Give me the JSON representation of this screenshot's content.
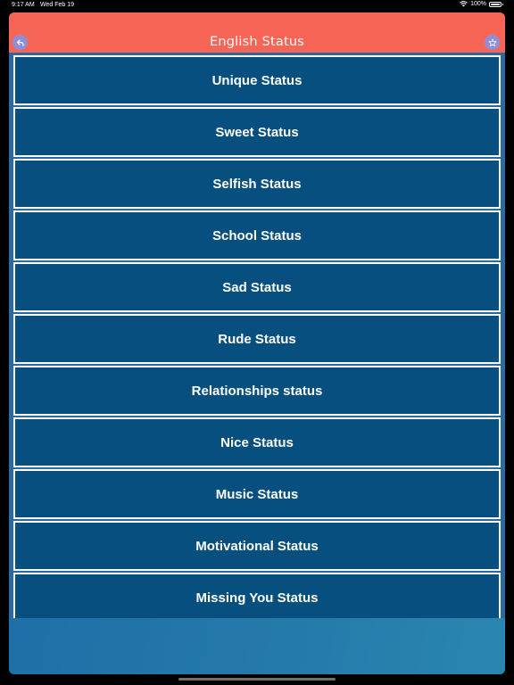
{
  "status_bar": {
    "time": "9:17 AM",
    "date": "Wed Feb 19",
    "battery": "100%"
  },
  "header": {
    "title": "English Status",
    "back_icon": "back-arrow-icon",
    "favorite_icon": "star-icon"
  },
  "items": [
    {
      "label": "Unique Status"
    },
    {
      "label": "Sweet Status"
    },
    {
      "label": "Selfish Status"
    },
    {
      "label": "School Status"
    },
    {
      "label": "Sad Status"
    },
    {
      "label": "Rude Status"
    },
    {
      "label": "Relationships status"
    },
    {
      "label": "Nice Status"
    },
    {
      "label": "Music Status"
    },
    {
      "label": "Motivational Status"
    },
    {
      "label": "Missing You Status"
    }
  ],
  "colors": {
    "header": "#f76557",
    "item_background": "#074f7f",
    "list_background": "#2a6aa4",
    "item_border": "#ffffff",
    "icon_button": "#8f8fd6"
  }
}
